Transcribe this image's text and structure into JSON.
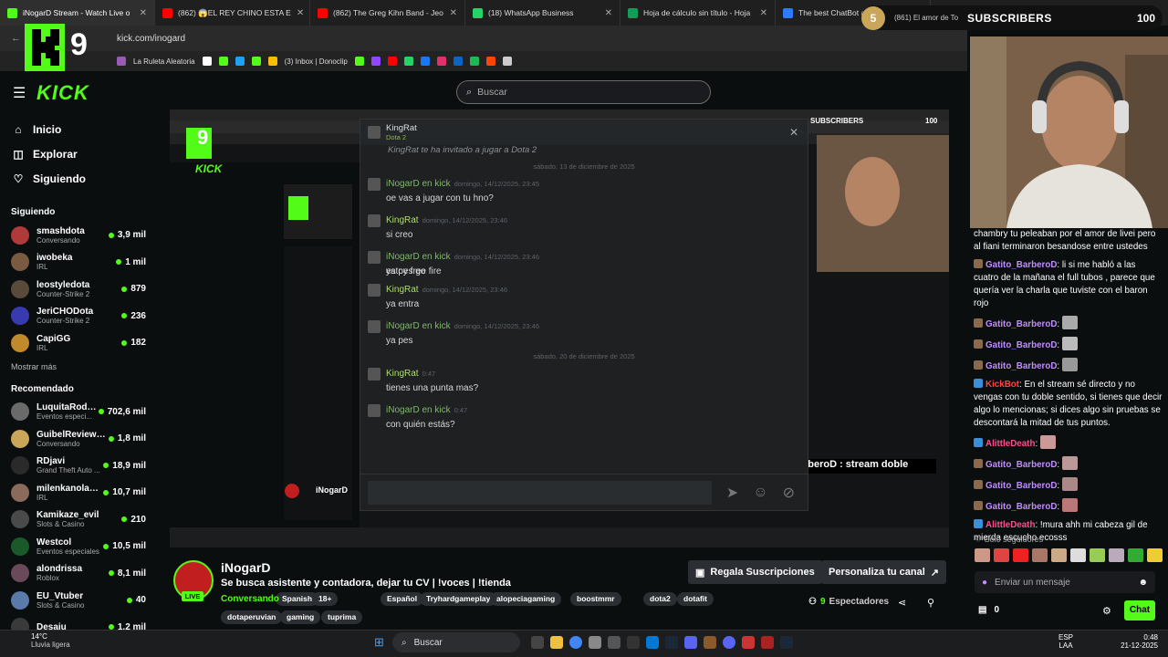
{
  "browser": {
    "tabs": [
      {
        "label": "iNogarD Stream - Watch Live o",
        "color": "#53fc18",
        "active": true
      },
      {
        "label": "(862) 😱EL REY CHINO ESTA E",
        "color": "#ff0000",
        "active": false
      },
      {
        "label": "(862) The Greg Kihn Band - Jeo",
        "color": "#ff0000",
        "active": false
      },
      {
        "label": "(18) WhatsApp Business",
        "color": "#25d366",
        "active": false
      },
      {
        "label": "Hoja de cálculo sin título - Hoja",
        "color": "#0f9d58",
        "active": false
      },
      {
        "label": "The best ChatBot and Widge",
        "color": "#2b7cff",
        "active": false
      }
    ],
    "url": "kick.com/inogard",
    "bookmarks": [
      "La Ruleta Aleatoria",
      "(3) Inbox | Donoclip"
    ]
  },
  "overlay": {
    "logo_letter": "K",
    "logo_number": "9",
    "sub_count_badge": "5",
    "sub_label": "SUBSCRIBERS",
    "sub_total": "100",
    "sub_tab": "(861) El amor de Tom"
  },
  "kick": {
    "brand": "KICK",
    "search_placeholder": "Buscar",
    "nav": [
      {
        "label": "Inicio",
        "icon": "home-icon",
        "glyph": "⌂"
      },
      {
        "label": "Explorar",
        "icon": "compass-icon",
        "glyph": "◫"
      },
      {
        "label": "Siguiendo",
        "icon": "heart-icon",
        "glyph": "♡"
      }
    ],
    "following_title": "Siguiendo",
    "following": [
      {
        "name": "smashdota",
        "game": "Conversando",
        "viewers": "3,9 mil",
        "color": "#b03a3a"
      },
      {
        "name": "iwobeka",
        "game": "IRL",
        "viewers": "1 mil",
        "color": "#7a5a40"
      },
      {
        "name": "leostyledota",
        "game": "Counter-Strike 2",
        "viewers": "879",
        "color": "#5a4a3a"
      },
      {
        "name": "JeriCHODota",
        "game": "Counter-Strike 2",
        "viewers": "236",
        "color": "#3a3ab0"
      },
      {
        "name": "CapiGG",
        "game": "IRL",
        "viewers": "182",
        "color": "#c08a2a"
      }
    ],
    "show_more": "Mostrar más",
    "recommended_title": "Recomendado",
    "recommended": [
      {
        "name": "LuquitaRodri...",
        "game": "Eventos especi...",
        "viewers": "702,6 mil",
        "color": "#6a6a6a"
      },
      {
        "name": "GuibelReviewsD...",
        "game": "Conversando",
        "viewers": "1,8 mil",
        "color": "#c9a65a"
      },
      {
        "name": "RDjavi",
        "game": "Grand Theft Auto ...",
        "viewers": "18,9 mil",
        "color": "#2a2a2a"
      },
      {
        "name": "milenkanolasco",
        "game": "IRL",
        "viewers": "10,7 mil",
        "color": "#8a6a5a"
      },
      {
        "name": "Kamikaze_evil",
        "game": "Slots & Casino",
        "viewers": "210",
        "color": "#4a4a4a"
      },
      {
        "name": "Westcol",
        "game": "Eventos especiales",
        "viewers": "10,5 mil",
        "color": "#1a5a2a"
      },
      {
        "name": "alondrissa",
        "game": "Roblox",
        "viewers": "8,1 mil",
        "color": "#6a4a5a"
      },
      {
        "name": "EU_Vtuber",
        "game": "Slots & Casino",
        "viewers": "40",
        "color": "#5a7aaa"
      },
      {
        "name": "Desaju",
        "game": "",
        "viewers": "1,2 mil",
        "color": "#3a3a3a"
      }
    ]
  },
  "video": {
    "steam_chat": {
      "contact": "KingRat",
      "contact_status": "Dota 2",
      "invite_text": "KingRat te ha invitado a jugar a  Dota 2",
      "date1": "sábado, 13 de diciembre de 2025",
      "messages1": [
        {
          "author": "iNogarD en kick",
          "date": "domingo, 14/12/2025, 23:45",
          "text": "oe vas a jugar con tu hno?"
        },
        {
          "author": "KingRat",
          "date": "domingo, 14/12/2025, 23:46",
          "text": "si creo"
        },
        {
          "author": "iNogarD en kick",
          "date": "domingo, 14/12/2025, 23:46",
          "text": "ya pes go"
        },
        {
          "author": "",
          "date": "",
          "text": "estoy free fire"
        },
        {
          "author": "KingRat",
          "date": "domingo, 14/12/2025, 23:46",
          "text": "ya entra"
        },
        {
          "author": "iNogarD en kick",
          "date": "domingo, 14/12/2025, 23:46",
          "text": "ya pes"
        }
      ],
      "date2": "sábado, 20 de diciembre de 2025",
      "messages2": [
        {
          "author": "KingRat",
          "date": "0:47",
          "text": "tienes una punta mas?"
        },
        {
          "author": "iNogarD en kick",
          "date": "0:47",
          "text": "con quién estás?"
        }
      ]
    },
    "overlay_chat_line": "Gatito_BarberoD : stream doble"
  },
  "stream": {
    "name": "iNogarD",
    "live": "LIVE",
    "title": "Se busca asistente y contadora, dejar tu CV | !voces | !tienda",
    "category": "Conversando",
    "tags_row1": [
      "Spanish",
      "18+",
      "Español",
      "Tryhardgameplay",
      "alopeciagaming",
      "boostmmr",
      "dota2",
      "dotafit"
    ],
    "tags_row2": [
      "dotaperuvian",
      "gaming",
      "tuprima"
    ],
    "gift_subs": "Regala Suscripciones",
    "customize": "Personaliza tu canal",
    "viewers_count": "9",
    "viewers_label": "Espectadores"
  },
  "chat": {
    "top_partial_1": "chambry tu peleaban por el amor de livei pero",
    "top_partial_2": "al fiani terminaron besandose entre ustedes",
    "messages": [
      {
        "user": "Gatito_BarberoD",
        "color": "#c08cff",
        "text": "li si me habló a las cuatro de la mañana el full tubos , parece que quería ver la charla que tuviste con el baron rojo",
        "emote": false
      },
      {
        "user": "Gatito_BarberoD",
        "color": "#c08cff",
        "text": "",
        "emote": true
      },
      {
        "user": "Gatito_BarberoD",
        "color": "#c08cff",
        "text": "",
        "emote": true
      },
      {
        "user": "Gatito_BarberoD",
        "color": "#c08cff",
        "text": "",
        "emote": true
      },
      {
        "user": "KickBot",
        "color": "#ff4545",
        "text": "En el stream sé directo y no vengas con tu doble sentido, si tienes que decir algo lo mencionas; si dices algo sin pruebas se descontará la mitad de tus puntos.",
        "emote": false
      },
      {
        "user": "AlittleDeath",
        "color": "#ff4f8a",
        "text": "",
        "emote": true
      },
      {
        "user": "Gatito_BarberoD",
        "color": "#c08cff",
        "text": "",
        "emote": true
      },
      {
        "user": "Gatito_BarberoD",
        "color": "#c08cff",
        "text": "",
        "emote": true
      },
      {
        "user": "Gatito_BarberoD",
        "color": "#c08cff",
        "text": "",
        "emote": true
      },
      {
        "user": "AlittleDeath",
        "color": "#ff4f8a",
        "text": "!mura ahh mi cabeza gil de mierda escucho ecosss",
        "emote": false
      },
      {
        "user": "Gatito_BarberoD",
        "color": "#c08cff",
        "text": "stream doble",
        "emote": false
      }
    ],
    "followers_only": "Solo seguidores",
    "input_placeholder": "Enviar un mensaje",
    "points": "0",
    "send_label": "Chat"
  },
  "taskbar": {
    "weather_temp": "14°C",
    "weather_desc": "Lluvia ligera",
    "search": "Buscar",
    "lang": "ESP",
    "lang2": "LAA",
    "time": "0:48",
    "date": "21-12-2025"
  },
  "colors": {
    "accent": "#53fc18",
    "bg": "#0b0e0f"
  }
}
